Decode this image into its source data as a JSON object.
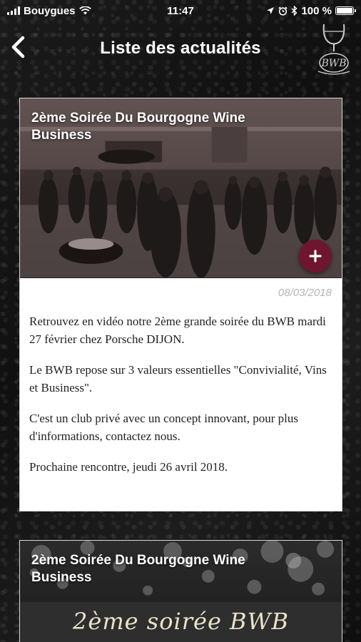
{
  "status_bar": {
    "carrier": "Bouygues",
    "time": "11:47",
    "battery": "100 %",
    "battery_level": 1.0,
    "icons": [
      "signal-icon",
      "wifi-icon",
      "location-icon",
      "alarm-icon",
      "bluetooth-icon",
      "battery-icon"
    ]
  },
  "header": {
    "title": "Liste des actualités",
    "back_icon": "chevron-left-icon",
    "logo_icon": "bwb-wine-glass-logo",
    "logo_text": "BWB"
  },
  "articles": [
    {
      "title": "2ème Soirée Du Bourgogne Wine Business",
      "date": "08/03/2018",
      "image": "event-crowd-photo",
      "action_icon": "plus-icon",
      "paragraphs": [
        "Retrouvez en vidéo notre 2ème grande soirée du BWB mardi 27 février chez Porsche DIJON.",
        "Le BWB repose sur 3 valeurs essentielles \"Convivialité, Vins et Business\".",
        "C'est un club privé avec un concept innovant, pour plus d'informations, contactez nous.",
        "Prochaine rencontre, jeudi 26 avril 2018."
      ]
    },
    {
      "title": "2ème Soirée Du Bourgogne Wine Business",
      "image": "bokeh-banner",
      "banner_text": "2ème soirée BWB"
    }
  ],
  "colors": {
    "accent": "#6e1630",
    "card_bg": "#ffffff",
    "date": "#b5b5b5",
    "body_text": "#222222"
  }
}
